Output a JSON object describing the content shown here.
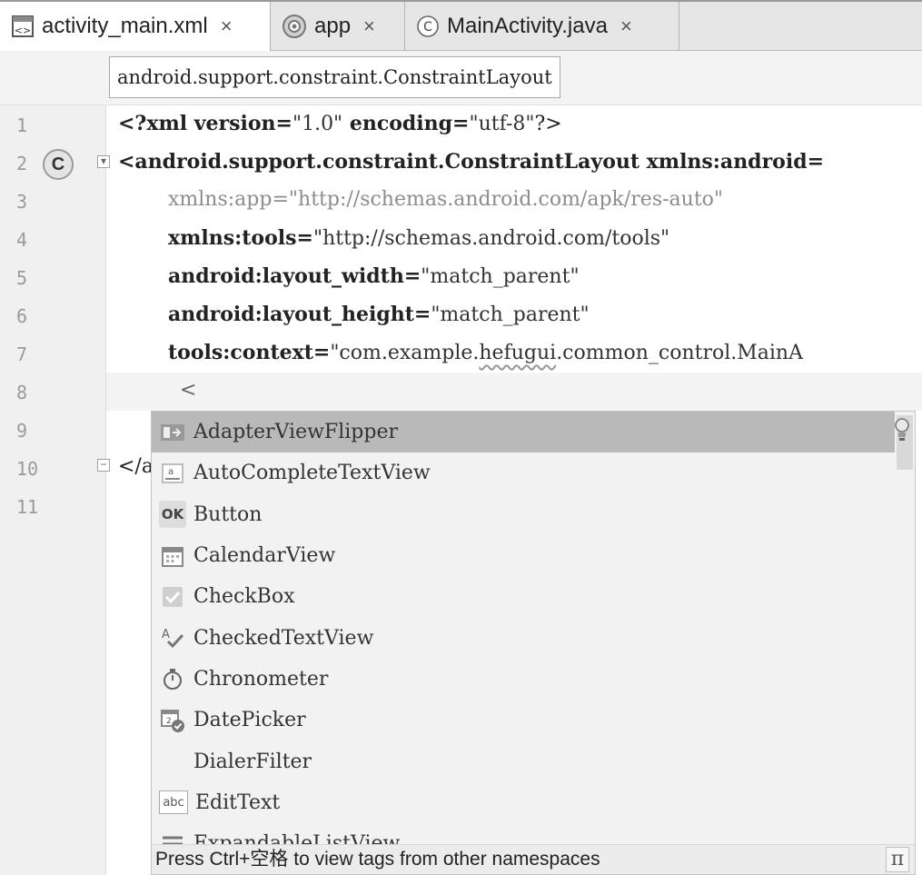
{
  "tabs": [
    {
      "label": "activity_main.xml",
      "close": "×",
      "icon": "xml-file-icon",
      "active": true
    },
    {
      "label": "app",
      "close": "×",
      "icon": "android-module-icon",
      "active": false
    },
    {
      "label": "MainActivity.java",
      "close": "×",
      "icon": "java-class-icon",
      "active": false
    }
  ],
  "breadcrumb": "android.support.constraint.ConstraintLayout",
  "gutter": {
    "line_numbers": [
      "1",
      "2",
      "3",
      "4",
      "5",
      "6",
      "7",
      "8",
      "9",
      "10",
      "11"
    ],
    "class_badge": "C"
  },
  "code": {
    "line1": {
      "prefix": "<?xml version=",
      "v1": "\"1.0\"",
      "mid": " encoding=",
      "v2": "\"utf-8\"",
      "suffix": "?>"
    },
    "line2": "<android.support.constraint.ConstraintLayout xmlns:android=",
    "line3": {
      "attr": "xmlns:app=",
      "val": "\"http://schemas.android.com/apk/res-auto\""
    },
    "line4": {
      "attr": "xmlns:tools=",
      "val": "\"http://schemas.android.com/tools\""
    },
    "line5": {
      "attr": "android:layout_width=",
      "val": "\"match_parent\""
    },
    "line6": {
      "attr": "android:layout_height=",
      "val": "\"match_parent\""
    },
    "line7": {
      "attr": "tools:context=",
      "val_a": "\"com.example.",
      "val_b": "hefugui",
      "val_c": ".common_control.MainA"
    },
    "line8": "<",
    "line10": "</a"
  },
  "completion": {
    "items": [
      {
        "label": "AdapterViewFlipper",
        "icon": "adapterviewflipper-icon",
        "selected": true
      },
      {
        "label": "AutoCompleteTextView",
        "icon": "autocomplete-icon",
        "selected": false
      },
      {
        "label": "Button",
        "icon": "button-ok-icon",
        "icon_text": "OK",
        "selected": false
      },
      {
        "label": "CalendarView",
        "icon": "calendar-icon",
        "selected": false
      },
      {
        "label": "CheckBox",
        "icon": "checkbox-icon",
        "selected": false
      },
      {
        "label": "CheckedTextView",
        "icon": "checked-text-icon",
        "selected": false
      },
      {
        "label": "Chronometer",
        "icon": "stopwatch-icon",
        "selected": false
      },
      {
        "label": "DatePicker",
        "icon": "datepicker-icon",
        "selected": false
      },
      {
        "label": "DialerFilter",
        "icon": "",
        "selected": false
      },
      {
        "label": "EditText",
        "icon": "edittext-icon",
        "icon_text": "abc",
        "selected": false
      },
      {
        "label": "ExpandableListView",
        "icon": "expandable-list-icon",
        "selected": false
      }
    ],
    "status": "Press Ctrl+空格 to view tags from other namespaces",
    "pi_symbol": "π"
  }
}
